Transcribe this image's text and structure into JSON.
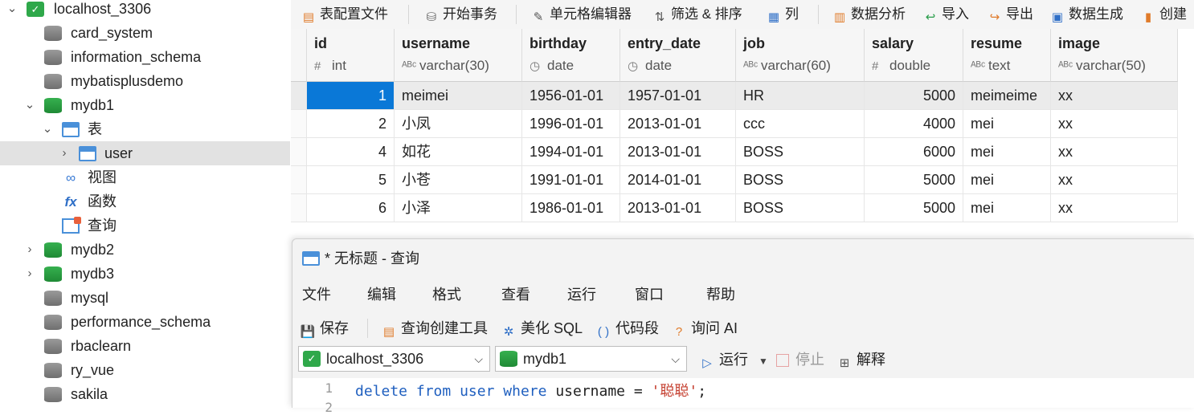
{
  "tree": {
    "connection": "localhost_3306",
    "databases_before": [
      "card_system",
      "information_schema",
      "mybatisplusdemo"
    ],
    "open_db": "mydb1",
    "tables_folder": "表",
    "selected_table": "user",
    "views_folder": "视图",
    "functions_folder": "函数",
    "queries_folder": "查询",
    "databases_after": [
      "mydb2",
      "mydb3",
      "mysql",
      "performance_schema",
      "rbaclearn",
      "ry_vue",
      "sakila"
    ]
  },
  "toolbar": {
    "table_config": "表配置文件",
    "begin_transaction": "开始事务",
    "cell_editor": "单元格编辑器",
    "filter_sort": "筛选 & 排序",
    "columns": "列",
    "data_analysis": "数据分析",
    "import": "导入",
    "export": "导出",
    "data_generation": "数据生成",
    "create": "创建"
  },
  "grid": {
    "columns": [
      {
        "name": "id",
        "type": "int",
        "type_icon": "#"
      },
      {
        "name": "username",
        "type": "varchar(30)",
        "type_icon": "ABC"
      },
      {
        "name": "birthday",
        "type": "date",
        "type_icon": "clock"
      },
      {
        "name": "entry_date",
        "type": "date",
        "type_icon": "clock"
      },
      {
        "name": "job",
        "type": "varchar(60)",
        "type_icon": "ABC"
      },
      {
        "name": "salary",
        "type": "double",
        "type_icon": "#"
      },
      {
        "name": "resume",
        "type": "text",
        "type_icon": "ABC"
      },
      {
        "name": "image",
        "type": "varchar(50)",
        "type_icon": "ABC"
      }
    ],
    "rows": [
      [
        "1",
        "meimei",
        "1956-01-01",
        "1957-01-01",
        "HR",
        "5000",
        "meimeime",
        "xx"
      ],
      [
        "2",
        "小凤",
        "1996-01-01",
        "2013-01-01",
        "ccc",
        "4000",
        "mei",
        "xx"
      ],
      [
        "4",
        "如花",
        "1994-01-01",
        "2013-01-01",
        "BOSS",
        "6000",
        "mei",
        "xx"
      ],
      [
        "5",
        "小苍",
        "1991-01-01",
        "2014-01-01",
        "BOSS",
        "5000",
        "mei",
        "xx"
      ],
      [
        "6",
        "小泽",
        "1986-01-01",
        "2013-01-01",
        "BOSS",
        "5000",
        "mei",
        "xx"
      ]
    ]
  },
  "query": {
    "title": "* 无标题 - 查询",
    "menu": [
      "文件",
      "编辑",
      "格式",
      "查看",
      "运行",
      "窗口",
      "帮助"
    ],
    "save": "保存",
    "query_builder": "查询创建工具",
    "beautify": "美化 SQL",
    "snippet": "代码段",
    "ask_ai": "询问 AI",
    "connection": "localhost_3306",
    "database": "mydb1",
    "run": "运行",
    "stop": "停止",
    "explain": "解释",
    "line1": "1",
    "line2": "2",
    "code": {
      "kw1": "delete",
      "kw2": "from",
      "ident": "user",
      "kw3": "where",
      "rest": "username = ",
      "str": "'聪聪'",
      "end": ";"
    }
  }
}
